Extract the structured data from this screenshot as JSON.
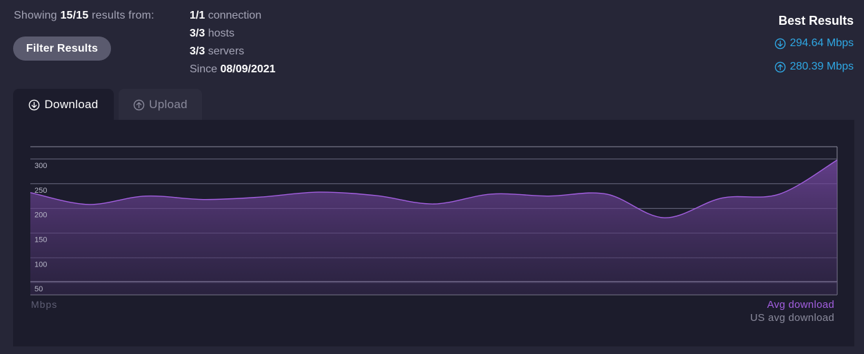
{
  "summary": {
    "showing_prefix": "Showing",
    "showing_count": "15/15",
    "showing_suffix": "results from:",
    "filter_button": "Filter Results"
  },
  "stats": [
    {
      "value": "1/1",
      "label": "connection"
    },
    {
      "value": "3/3",
      "label": "hosts"
    },
    {
      "value": "3/3",
      "label": "servers"
    },
    {
      "label": "Since",
      "value": "08/09/2021"
    }
  ],
  "best_results": {
    "title": "Best Results",
    "download": "294.64 Mbps",
    "upload": "280.39 Mbps",
    "download_icon": "arrow-down-circle-icon",
    "upload_icon": "arrow-up-circle-icon"
  },
  "tabs": [
    {
      "label": "Download",
      "icon": "arrow-down-circle-icon",
      "active": true
    },
    {
      "label": "Upload",
      "icon": "arrow-up-circle-icon",
      "active": false
    }
  ],
  "legend": {
    "unit": "Mbps",
    "avg_download": "Avg download",
    "us_avg_download": "US avg download"
  },
  "colors": {
    "accent_blue": "#2fa8e4",
    "avg_line": "#a35fe0",
    "background": "#262637",
    "panel": "#1c1c2c"
  },
  "chart_data": {
    "type": "area",
    "title": "",
    "xlabel": "",
    "ylabel": "Mbps",
    "ylim": [
      25,
      325
    ],
    "yticks": [
      50,
      100,
      150,
      200,
      250,
      300
    ],
    "series": [
      {
        "name": "Avg download",
        "values": [
          232,
          208,
          225,
          218,
          223,
          233,
          226,
          209,
          229,
          225,
          229,
          181,
          221,
          229,
          298
        ]
      }
    ],
    "reference_line": {
      "name": "US avg download",
      "value": 52
    },
    "grid": true
  }
}
